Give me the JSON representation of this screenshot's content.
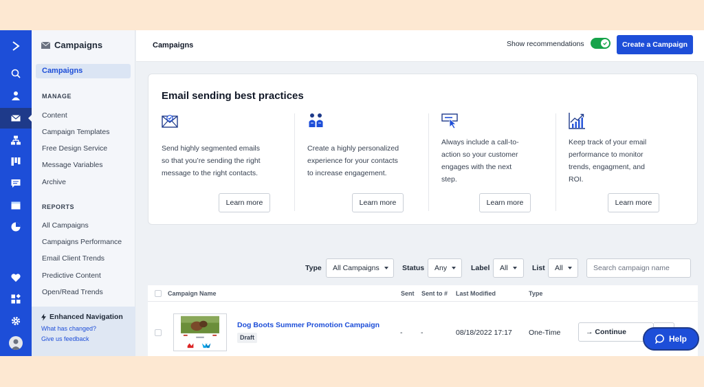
{
  "sidebar": {
    "title": "Campaigns",
    "active_item": "Campaigns",
    "sections": [
      {
        "heading": "MANAGE",
        "items": [
          "Content",
          "Campaign Templates",
          "Free Design Service",
          "Message Variables",
          "Archive"
        ]
      },
      {
        "heading": "REPORTS",
        "items": [
          "All Campaigns",
          "Campaigns Performance",
          "Email Client Trends",
          "Predictive Content",
          "Open/Read Trends"
        ]
      }
    ],
    "enhanced_nav": {
      "title": "Enhanced Navigation",
      "links": [
        "What has changed?",
        "Give us feedback"
      ]
    }
  },
  "rail": {
    "icons": [
      "logo-chevron-icon",
      "search-icon",
      "contacts-icon",
      "email-icon",
      "automations-icon",
      "deals-icon",
      "conversations-icon",
      "website-icon",
      "reports-icon",
      "heart-icon",
      "apps-icon",
      "settings-icon",
      "avatar-icon"
    ],
    "accent": "#1d4ed8"
  },
  "header": {
    "title": "Campaigns",
    "show_recommendations_label": "Show recommendations",
    "show_recommendations_on": true,
    "create_button_label": "Create a Campaign"
  },
  "best_practices": {
    "title": "Email sending best practices",
    "tips": [
      {
        "icon": "email-check-icon",
        "lines": [
          "Send highly segmented emails",
          "so that you’re sending the right",
          "message to the right contacts."
        ],
        "button": "Learn more"
      },
      {
        "icon": "people-icon",
        "lines": [
          "Create a highly personalized",
          "experience for your contacts",
          "to increase engagement."
        ],
        "button": "Learn more"
      },
      {
        "icon": "cta-click-icon",
        "lines": [
          "Always include a call-to-",
          "action so your customer",
          "engages with the next",
          "step."
        ],
        "button": "Learn more"
      },
      {
        "icon": "chart-growth-icon",
        "lines": [
          "Keep track of your email",
          "performance to monitor",
          "trends, engagment, and",
          "ROI."
        ],
        "button": "Learn more"
      }
    ]
  },
  "filters": {
    "type_label": "Type",
    "type_value": "All Campaigns",
    "status_label": "Status",
    "status_value": "Any",
    "label_label": "Label",
    "label_value": "All",
    "list_label": "List",
    "list_value": "All",
    "search_placeholder": "Search campaign name"
  },
  "table": {
    "columns": [
      "Campaign Name",
      "Sent",
      "Sent to #",
      "Last Modified",
      "Type"
    ],
    "rows": [
      {
        "name": "Dog Boots Summer Promotion Campaign",
        "status": "Draft",
        "sent": "-",
        "sent_to": "-",
        "last_modified": "08/18/2022 17:17",
        "type": "One-Time",
        "action": "Continue"
      }
    ]
  },
  "help_label": "Help"
}
